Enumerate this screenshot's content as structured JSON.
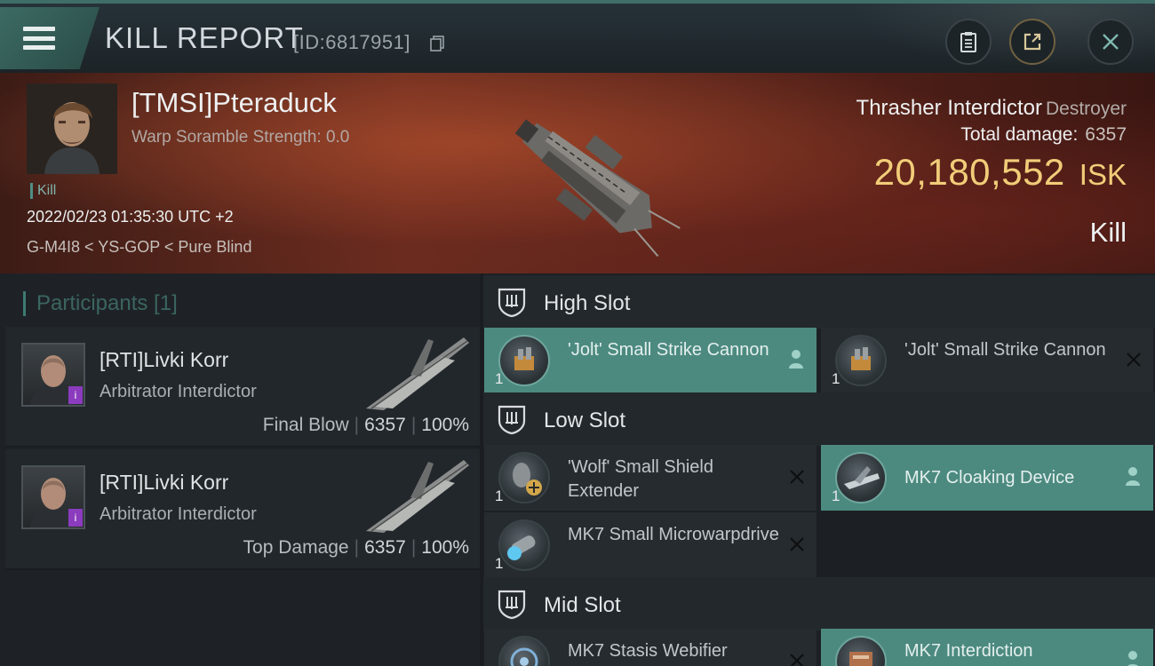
{
  "header": {
    "title": "KILL REPORT",
    "id_label": "[ID:6817951]"
  },
  "victim": {
    "name": "[TMSI]Pteraduck",
    "scramble": "Warp Soramble Strength: 0.0",
    "tag": "Kill",
    "timestamp": "2022/02/23 01:35:30 UTC +2",
    "location": "G-M4I8 < YS-GOP < Pure Blind",
    "ship_name": "Thrasher Interdictor",
    "ship_class": "Destroyer",
    "total_damage_label": "Total damage:",
    "total_damage": "6357",
    "isk_value": "20,180,552",
    "isk_unit": "ISK",
    "result": "Kill"
  },
  "participants": {
    "header": "Participants [1]",
    "rows": [
      {
        "name": "[RTI]Livki Korr",
        "ship": "Arbitrator Interdictor",
        "stat_label": "Final Blow",
        "damage": "6357",
        "percent": "100%",
        "badge": "i"
      },
      {
        "name": "[RTI]Livki Korr",
        "ship": "Arbitrator Interdictor",
        "stat_label": "Top Damage",
        "damage": "6357",
        "percent": "100%",
        "badge": "i"
      }
    ]
  },
  "fittings": {
    "high_slot": {
      "title": "High Slot",
      "modules": [
        {
          "name": "'Jolt' Small Strike Cannon",
          "qty": "1",
          "state": "active",
          "icon": "cannon-icon"
        },
        {
          "name": "'Jolt' Small Strike Cannon",
          "qty": "1",
          "state": "destroyed",
          "icon": "cannon-icon"
        }
      ]
    },
    "low_slot": {
      "title": "Low Slot",
      "modules": [
        {
          "name": "'Wolf' Small Shield Extender",
          "qty": "1",
          "state": "destroyed",
          "icon": "shield-extender-icon"
        },
        {
          "name": "MK7 Cloaking Device",
          "qty": "1",
          "state": "active",
          "icon": "cloaking-device-icon"
        },
        {
          "name": "MK7 Small Microwarpdrive",
          "qty": "1",
          "state": "destroyed",
          "icon": "microwarpdrive-icon"
        }
      ]
    },
    "mid_slot": {
      "title": "Mid Slot",
      "modules": [
        {
          "name": "MK7 Stasis Webifier",
          "qty": "1",
          "state": "destroyed",
          "icon": "stasis-webifier-icon"
        },
        {
          "name": "MK7 Interdiction",
          "qty": "1",
          "state": "active",
          "icon": "interdiction-icon"
        }
      ]
    }
  },
  "colors": {
    "accent_teal": "#4c8a80",
    "isk_gold": "#f2cd79",
    "panel_dark": "#1c2024",
    "corp_badge": "#8b3bbd"
  }
}
